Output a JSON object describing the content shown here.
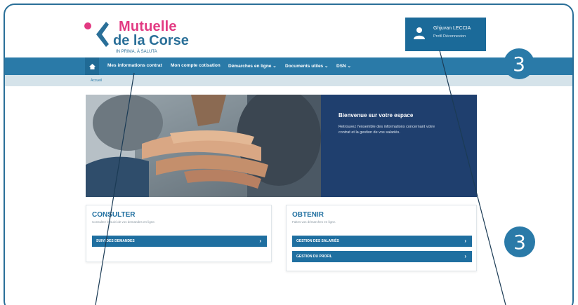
{
  "logo": {
    "line1": "Mutuelle",
    "line2": "de la Corse",
    "tagline": "IN PRIMA, À SALUTA"
  },
  "user": {
    "name": "Ghjuvan LECCIA",
    "links": "Profil  Déconnexion",
    "icon": "user-icon"
  },
  "nav": {
    "home_icon": "home-icon",
    "items": [
      {
        "label": "Mes informations contrat"
      },
      {
        "label": "Mon compte cotisation"
      },
      {
        "label": "Démarches en ligne ⌄"
      },
      {
        "label": "Documents utiles ⌄"
      },
      {
        "label": "DSN ⌄"
      }
    ]
  },
  "breadcrumb": "Accueil",
  "hero": {
    "title": "Bienvenue sur votre espace",
    "text": "Retrouvez l'ensemble des informations concernant votre contrat et la gestion de vos salariés."
  },
  "cards": {
    "consulter": {
      "title": "CONSULTER",
      "subtitle": "Consultez le suivi de vos demandes en ligne.",
      "buttons": [
        {
          "label": "SUIVI DES DEMANDES",
          "chevron": "›"
        }
      ]
    },
    "obtenir": {
      "title": "OBTENIR",
      "subtitle": "Faites vos démarches en ligne.",
      "buttons": [
        {
          "label": "GESTION DES SALARIÉS",
          "chevron": "›"
        },
        {
          "label": "GESTION DU PROFIL",
          "chevron": "›"
        }
      ]
    }
  },
  "annotations": {
    "badge_top": "3",
    "badge_right": "3"
  },
  "colors": {
    "brand_blue": "#2a7aa8",
    "brand_pink": "#e23a82",
    "hero_panel": "#1f3f6e"
  }
}
